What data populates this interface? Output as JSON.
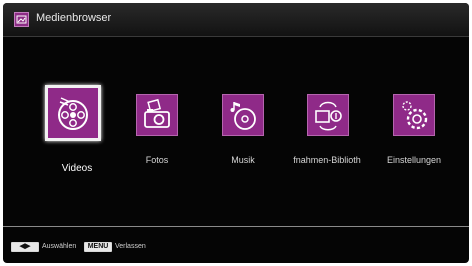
{
  "window": {
    "title": "Medienbrowser",
    "icon": "media-browser-icon"
  },
  "menu": {
    "items": [
      {
        "label": "Videos",
        "icon": "film-reel-icon",
        "selected": true
      },
      {
        "label": "Fotos",
        "icon": "photo-camera-icon",
        "selected": false
      },
      {
        "label": "Musik",
        "icon": "music-disc-icon",
        "selected": false
      },
      {
        "label": "fnahmen-Biblioth",
        "icon": "recordings-library-icon",
        "selected": false
      },
      {
        "label": "Einstellungen",
        "icon": "settings-gear-icon",
        "selected": false
      }
    ]
  },
  "footer": {
    "nav_key": "◀▶",
    "nav_label": "Auswählen",
    "menu_key": "MENU",
    "menu_label": "Verlassen"
  },
  "colors": {
    "accent": "#8f2a88",
    "background": "#050505"
  }
}
